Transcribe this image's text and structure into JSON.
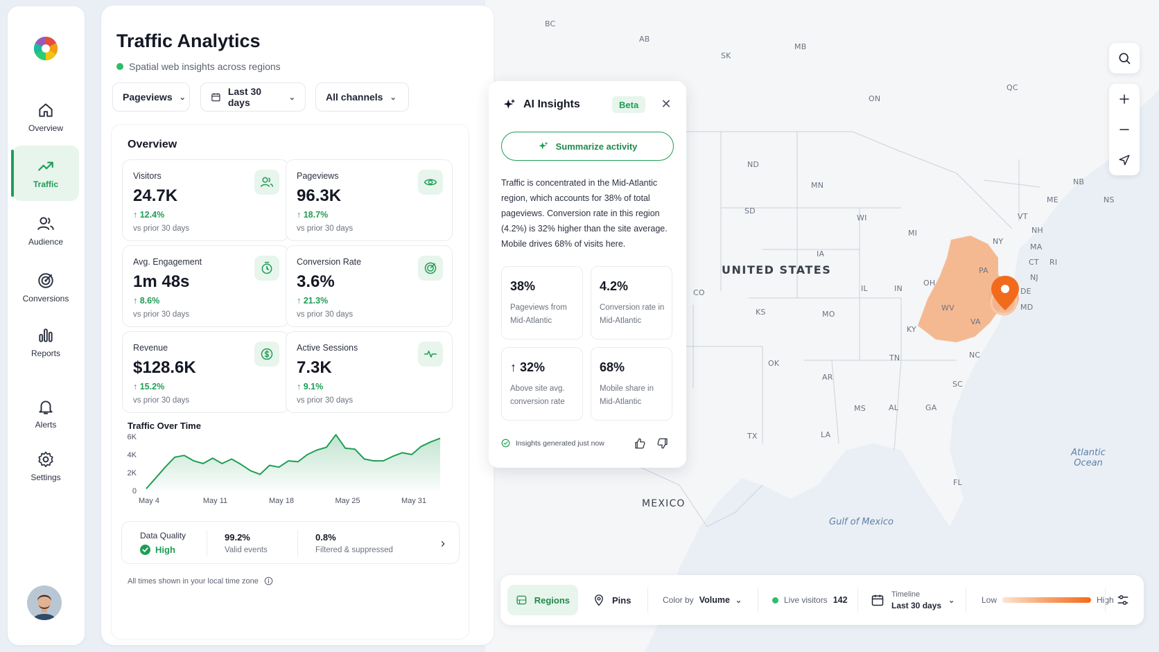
{
  "app": {
    "title": "Traffic Analytics",
    "subtitle": "Spatial web insights across regions"
  },
  "sidebar": {
    "items": [
      {
        "label": "Overview",
        "icon": "home-icon"
      },
      {
        "label": "Traffic",
        "icon": "trend-up-icon"
      },
      {
        "label": "Audience",
        "icon": "users-icon"
      },
      {
        "label": "Conversions",
        "icon": "target-icon"
      },
      {
        "label": "Reports",
        "icon": "bar-chart-icon"
      },
      {
        "label": "Alerts",
        "icon": "bell-icon"
      },
      {
        "label": "Settings",
        "icon": "gear-icon"
      }
    ],
    "active": "Traffic"
  },
  "filters": {
    "metric": "Pageviews",
    "range": "Last 30 days",
    "channel": "All channels"
  },
  "overview": {
    "title": "Overview",
    "kpis": [
      {
        "name": "Visitors",
        "value": "24.7K",
        "delta": "12.4%",
        "prior": "vs prior 30 days",
        "icon": "users-icon"
      },
      {
        "name": "Pageviews",
        "value": "96.3K",
        "delta": "18.7%",
        "prior": "vs prior 30 days",
        "icon": "eye-icon"
      },
      {
        "name": "Avg. Engagement",
        "value": "1m 48s",
        "delta": "8.6%",
        "prior": "vs prior 30 days",
        "icon": "clock-icon"
      },
      {
        "name": "Conversion Rate",
        "value": "3.6%",
        "delta": "21.3%",
        "prior": "vs prior 30 days",
        "icon": "target-icon"
      },
      {
        "name": "Revenue",
        "value": "$128.6K",
        "delta": "15.2%",
        "prior": "vs prior 30 days",
        "icon": "dollar-icon"
      },
      {
        "name": "Active Sessions",
        "value": "7.3K",
        "delta": "9.1%",
        "prior": "vs prior 30 days",
        "icon": "pulse-icon"
      }
    ],
    "chart_title": "Traffic Over Time"
  },
  "chart_data": {
    "type": "area",
    "title": "Traffic Over Time",
    "x_ticks": [
      "May 4",
      "May 11",
      "May 18",
      "May 25",
      "May 31"
    ],
    "y_ticks": [
      "0",
      "2K",
      "4K",
      "6K"
    ],
    "ylim": [
      0,
      6000
    ],
    "series": [
      {
        "values": [
          200,
          1400,
          2600,
          3700,
          3900,
          3300,
          3000,
          3600,
          3000,
          3500,
          2900,
          2200,
          1800,
          2800,
          2600,
          3300,
          3200,
          4000,
          4500,
          4800,
          6200,
          4700,
          4600,
          3500,
          3300,
          3300,
          3800,
          4200,
          4000,
          4900,
          5400,
          5800
        ]
      }
    ],
    "color": "#1f9d55"
  },
  "data_quality": {
    "label": "Data Quality",
    "status": "High",
    "valid_value": "99.2%",
    "valid_label": "Valid events",
    "filtered_value": "0.8%",
    "filtered_label": "Filtered & suppressed"
  },
  "footnote": "All times shown in your local time zone",
  "ai": {
    "title": "AI Insights",
    "badge": "Beta",
    "summarize": "Summarize activity",
    "text": "Traffic is concentrated in the Mid-Atlantic region, which accounts for 38% of total pageviews. Conversion rate in this region (4.2%) is 32% higher than the site average. Mobile drives 68% of visits here.",
    "stats": [
      {
        "value": "38%",
        "label": "Pageviews from Mid-Atlantic"
      },
      {
        "value": "4.2%",
        "label": "Conversion rate in Mid-Atlantic"
      },
      {
        "value": "↑ 32%",
        "label": "Above site avg. conversion rate"
      },
      {
        "value": "68%",
        "label": "Mobile share in Mid-Atlantic"
      }
    ],
    "footer": "Insights generated just now"
  },
  "map": {
    "country_label": "UNITED STATES",
    "neighbor_label": "MEXICO",
    "water_labels": [
      "Atlantic Ocean",
      "Gulf of Mexico"
    ],
    "region_labels": [
      "BC",
      "AB",
      "SK",
      "MB",
      "ON",
      "QC",
      "NB",
      "NS",
      "ME",
      "VT",
      "NH",
      "MA",
      "CT",
      "RI",
      "NY",
      "NJ",
      "PA",
      "DE",
      "MD",
      "VA",
      "WV",
      "NC",
      "SC",
      "GA",
      "FL",
      "AL",
      "MS",
      "TN",
      "KY",
      "OH",
      "IN",
      "IL",
      "MI",
      "WI",
      "MN",
      "IA",
      "MO",
      "AR",
      "LA",
      "TX",
      "OK",
      "KS",
      "SD",
      "ND",
      "CO"
    ],
    "highlight_color": "#f4b389",
    "pin_color": "#f26b1d"
  },
  "bottom_bar": {
    "regions": "Regions",
    "pins": "Pins",
    "color_by_label": "Color by",
    "color_by_value": "Volume",
    "live_label": "Live visitors",
    "live_value": "142",
    "timeline_label": "Timeline",
    "timeline_value": "Last 30 days",
    "legend_low": "Low",
    "legend_high": "High"
  }
}
